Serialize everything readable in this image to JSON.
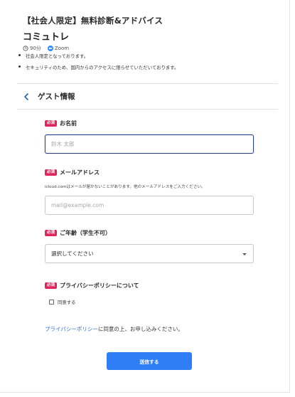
{
  "header": {
    "event_title": "【社会人限定】無料診断&アドバイス",
    "org_name": "コミュトレ",
    "duration": "90分",
    "platform": "Zoom",
    "icons": {
      "clock": "clock-icon",
      "video": "video-camera-icon"
    },
    "colors": {
      "zoom": "#2d8cff"
    }
  },
  "notes": [
    "社会人限定となっております。",
    "セキュリティのため、国内からのアクセスに限らせていただいております。"
  ],
  "guest_section": {
    "title": "ゲスト情報",
    "back_icon": "chevron-left-icon"
  },
  "required_badge": "必須",
  "form": {
    "name": {
      "label": "お名前",
      "placeholder": "鈴木 太郎",
      "value": ""
    },
    "email": {
      "label": "メールアドレス",
      "help": "icloud.comはメールが届かないことがあります。他のメールアドレスをご入力ください。",
      "placeholder": "mail@example.com",
      "value": ""
    },
    "age": {
      "label": "ご年齢（学生不可）",
      "selected": "選択してください"
    },
    "privacy": {
      "label": "プライバシーポリシーについて",
      "checkbox_label": "同意する",
      "checked": false
    }
  },
  "privacy_note": {
    "link_text": "プライバシーポリシー",
    "rest_text": "に同意の上、お申し込みください。"
  },
  "submit": {
    "label": "送信する"
  },
  "colors": {
    "accent": "#2f7ef5",
    "required": "#e0245e",
    "focus_border": "#2b3e8c",
    "link": "#2d6fd6"
  }
}
